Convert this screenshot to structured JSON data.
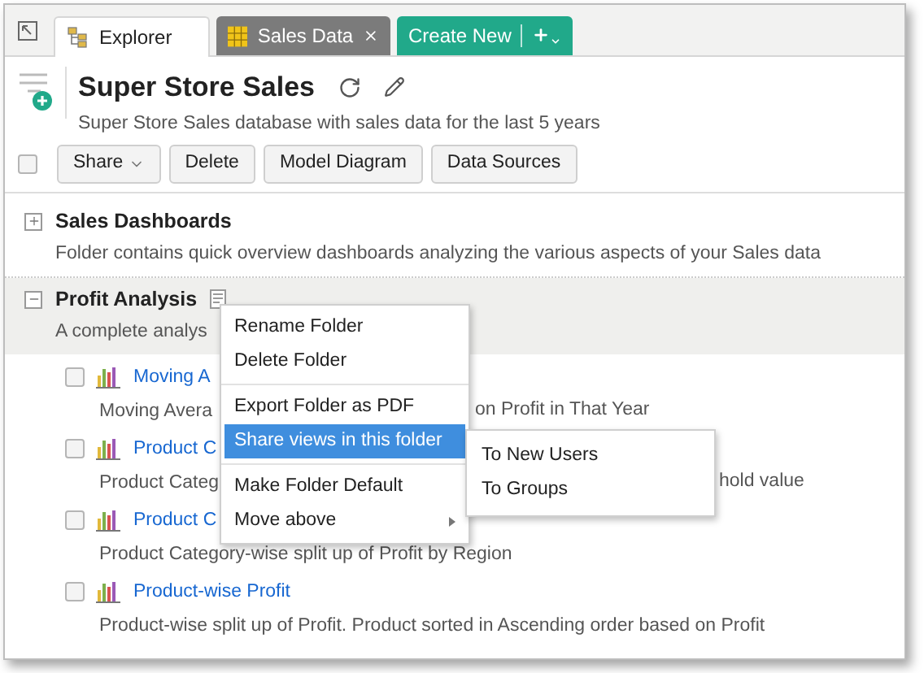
{
  "tabs": [
    {
      "label": "Explorer",
      "kind": "explorer",
      "selected": true,
      "closable": false
    },
    {
      "label": "Sales Data",
      "kind": "table",
      "selected": false,
      "closable": true
    }
  ],
  "create_button": {
    "label": "Create New"
  },
  "header": {
    "title": "Super Store Sales",
    "subtitle": "Super Store Sales database with sales data for the last 5 years"
  },
  "toolbar": {
    "select_all_checked": false,
    "buttons": [
      {
        "label": "Share",
        "dropdown": true
      },
      {
        "label": "Delete",
        "dropdown": false
      },
      {
        "label": "Model Diagram",
        "dropdown": false
      },
      {
        "label": "Data Sources",
        "dropdown": false
      }
    ]
  },
  "folders": [
    {
      "name": "Sales Dashboards",
      "description": "Folder contains quick overview dashboards analyzing the various aspects of your Sales data",
      "expanded": false,
      "selected": false
    },
    {
      "name": "Profit Analysis",
      "description": "A complete analys",
      "expanded": true,
      "selected": true,
      "items": [
        {
          "title": "Moving A",
          "checked": false,
          "description": "Moving Avera",
          "description_after": "on Profit in That Year"
        },
        {
          "title": "Product C",
          "checked": false,
          "description": "Product Categ",
          "description_after": "hold value"
        },
        {
          "title": "Product C",
          "checked": false,
          "description": "Product Category-wise split up of Profit by Region"
        },
        {
          "title": "Product-wise Profit",
          "checked": false,
          "description": "Product-wise split up of Profit. Product sorted in Ascending order based on Profit"
        }
      ]
    }
  ],
  "context_menu": {
    "groups": [
      [
        {
          "label": "Rename Folder",
          "selected": false,
          "submenu": false
        },
        {
          "label": "Delete Folder",
          "selected": false,
          "submenu": false
        }
      ],
      [
        {
          "label": "Export Folder as PDF",
          "selected": false,
          "submenu": false
        },
        {
          "label": "Share views in this folder",
          "selected": true,
          "submenu": false
        }
      ],
      [
        {
          "label": "Make Folder Default",
          "selected": false,
          "submenu": false
        },
        {
          "label": "Move above",
          "selected": false,
          "submenu": true
        }
      ]
    ]
  },
  "submenu": {
    "items": [
      {
        "label": "To New Users"
      },
      {
        "label": "To Groups"
      }
    ]
  }
}
